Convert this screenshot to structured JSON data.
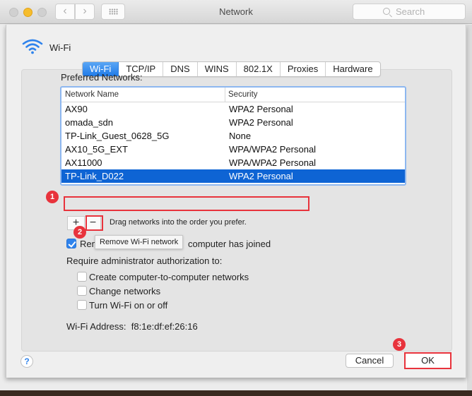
{
  "window": {
    "title": "Network",
    "search_placeholder": "Search"
  },
  "header": {
    "interface_label": "Wi-Fi",
    "icon": "wifi-icon"
  },
  "tabs": [
    {
      "label": "Wi-Fi",
      "active": true
    },
    {
      "label": "TCP/IP",
      "active": false
    },
    {
      "label": "DNS",
      "active": false
    },
    {
      "label": "WINS",
      "active": false
    },
    {
      "label": "802.1X",
      "active": false
    },
    {
      "label": "Proxies",
      "active": false
    },
    {
      "label": "Hardware",
      "active": false
    }
  ],
  "preferred": {
    "label": "Preferred Networks:",
    "columns": [
      "Network Name",
      "Security"
    ],
    "rows": [
      {
        "name": "AX90",
        "security": "WPA2 Personal"
      },
      {
        "name": "omada_sdn",
        "security": "WPA2 Personal"
      },
      {
        "name": "TP-Link_Guest_0628_5G",
        "security": "None"
      },
      {
        "name": "AX10_5G_EXT",
        "security": "WPA/WPA2 Personal"
      },
      {
        "name": "AX11000",
        "security": "WPA/WPA2 Personal"
      },
      {
        "name": "TP-Link_D022",
        "security": "WPA2 Personal",
        "selected": true
      }
    ],
    "add_label": "+",
    "remove_label": "−",
    "drag_hint": "Drag networks into the order you prefer.",
    "tooltip": "Remove Wi-Fi network"
  },
  "remember": {
    "label_start": "Rem",
    "label_end": "computer has joined",
    "checked": true
  },
  "admin": {
    "label": "Require administrator authorization to:",
    "options": [
      {
        "label": "Create computer-to-computer networks",
        "checked": false
      },
      {
        "label": "Change networks",
        "checked": false
      },
      {
        "label": "Turn Wi-Fi on or off",
        "checked": false
      }
    ]
  },
  "address": {
    "label": "Wi-Fi Address:",
    "value": "f8:1e:df:ef:26:16"
  },
  "footer": {
    "help_label": "?",
    "cancel_label": "Cancel",
    "ok_label": "OK"
  },
  "annotations": {
    "step1": "1",
    "step2": "2",
    "step3": "3",
    "highlight_color": "#e8333c"
  },
  "colors": {
    "accent": "#1f7ae8",
    "selection": "#0e64d4"
  }
}
